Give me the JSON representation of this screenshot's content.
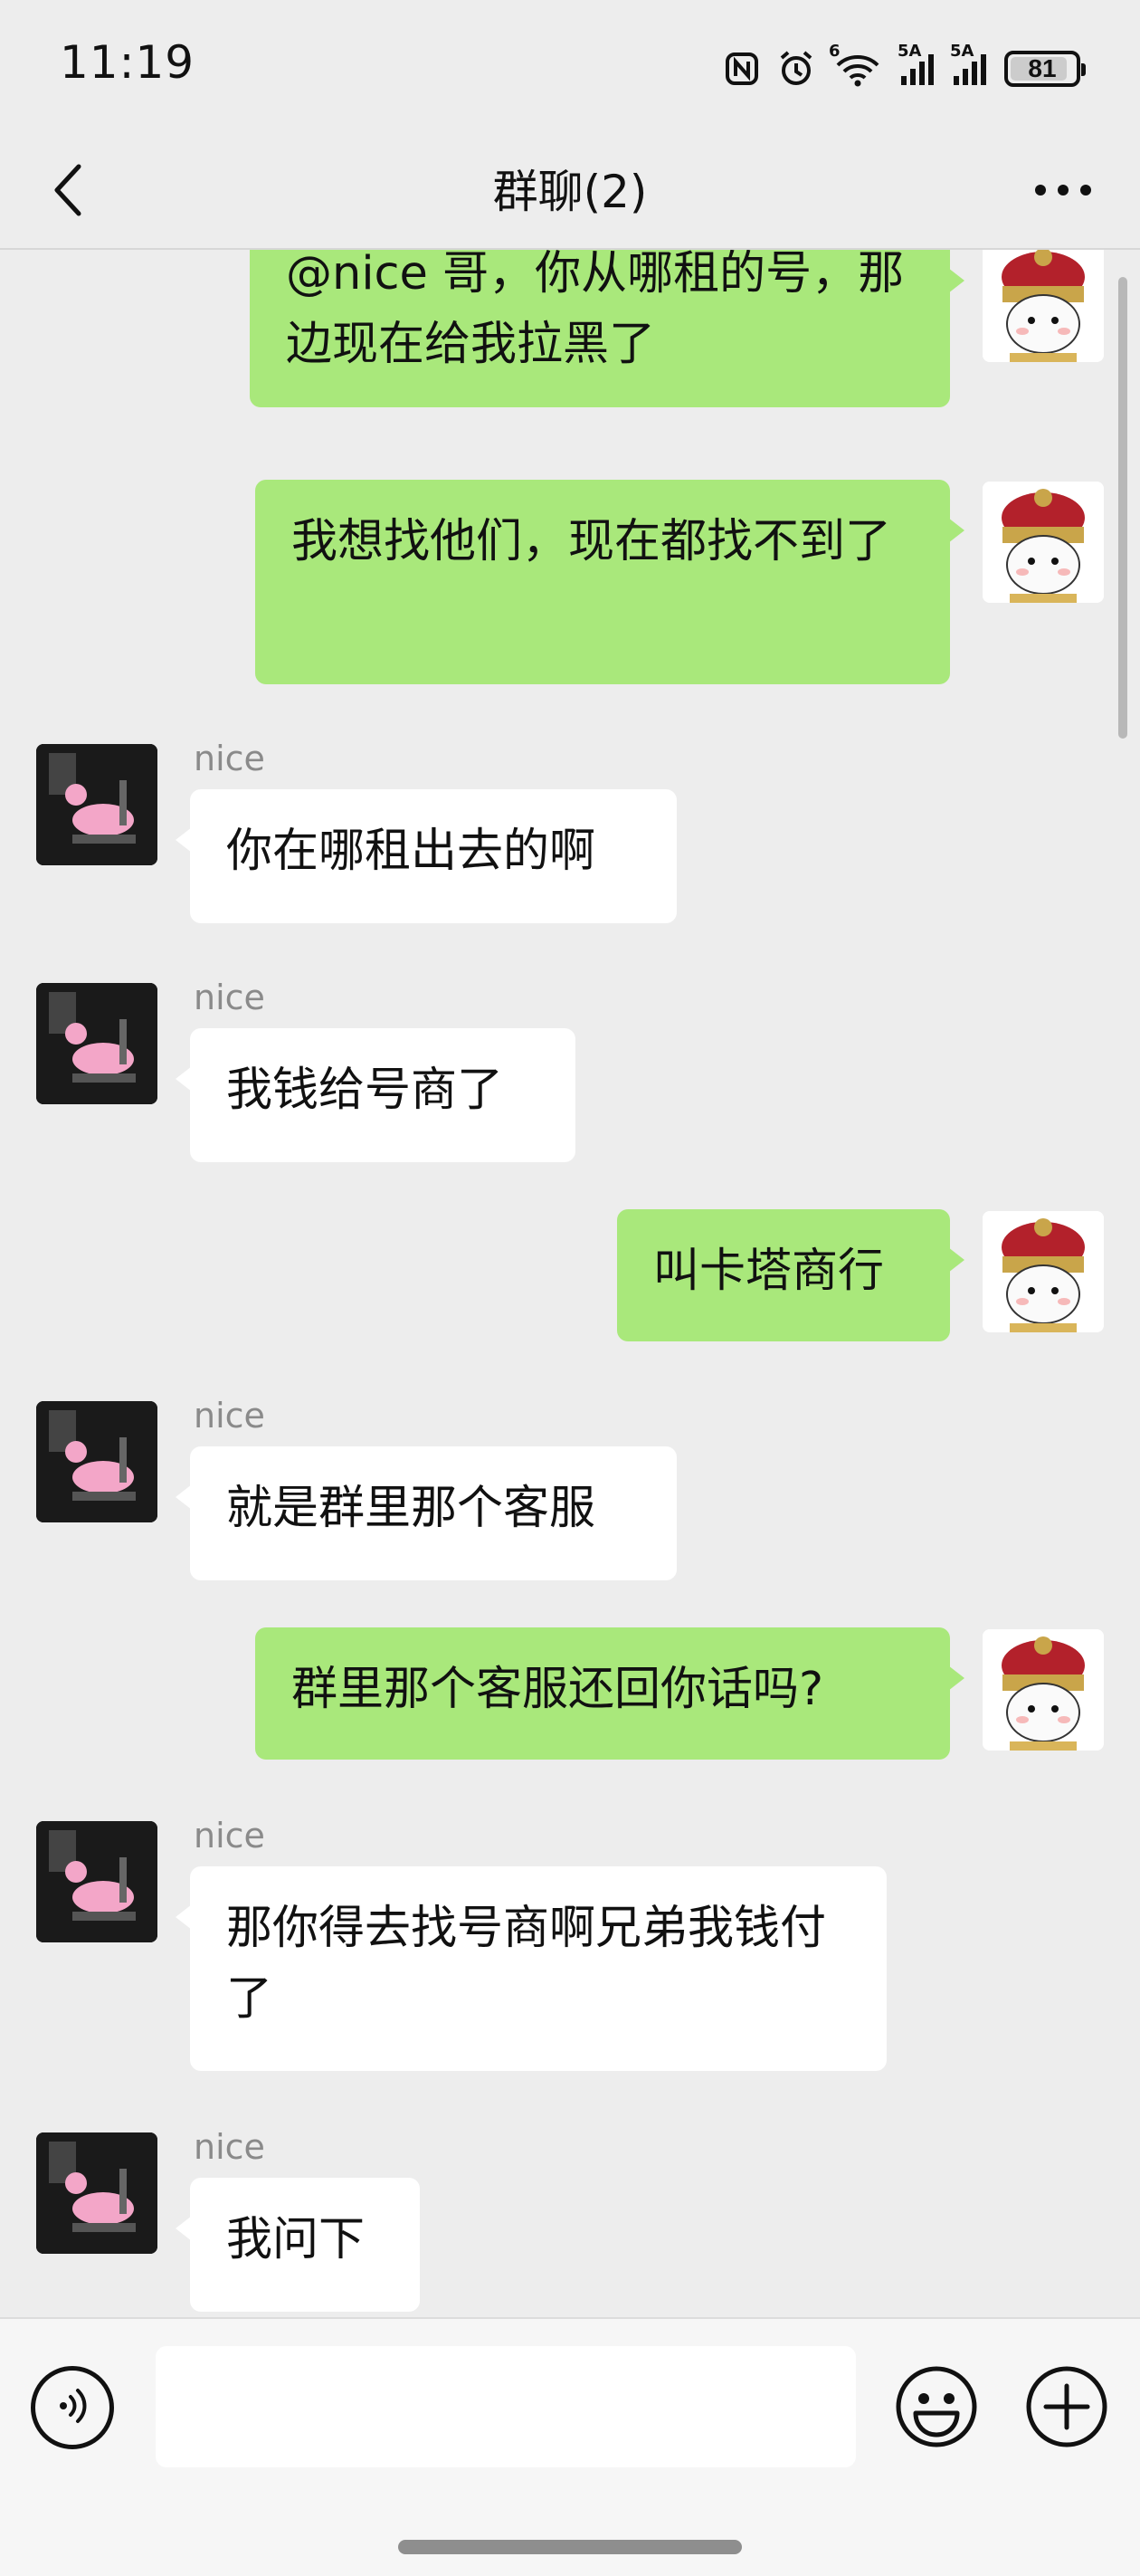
{
  "status_bar": {
    "time": "11:19",
    "battery": "81",
    "network_1": "5A",
    "network_2": "5A",
    "wifi_badge": "6"
  },
  "header": {
    "title": "群聊(2)"
  },
  "messages": [
    {
      "from": "self",
      "text": "@nice 哥，你从哪租的号，那边现在给我拉黑了"
    },
    {
      "from": "self",
      "text": "我想找他们，现在都找不到了"
    },
    {
      "from": "other",
      "sender": "nice",
      "text": "你在哪租出去的啊"
    },
    {
      "from": "other",
      "sender": "nice",
      "text": "我钱给号商了"
    },
    {
      "from": "self",
      "text": "叫卡塔商行"
    },
    {
      "from": "other",
      "sender": "nice",
      "text": "就是群里那个客服"
    },
    {
      "from": "self",
      "text": "群里那个客服还回你话吗?"
    },
    {
      "from": "other",
      "sender": "nice",
      "text": "那你得去找号商啊兄弟我钱付了"
    },
    {
      "from": "other",
      "sender": "nice",
      "text": "我问下"
    }
  ],
  "input": {
    "value": "",
    "placeholder": ""
  },
  "icons": {
    "back": "chevron-left-icon",
    "more": "more-dots-icon",
    "voice": "voice-icon",
    "emoji": "emoji-icon",
    "plus": "plus-icon"
  }
}
